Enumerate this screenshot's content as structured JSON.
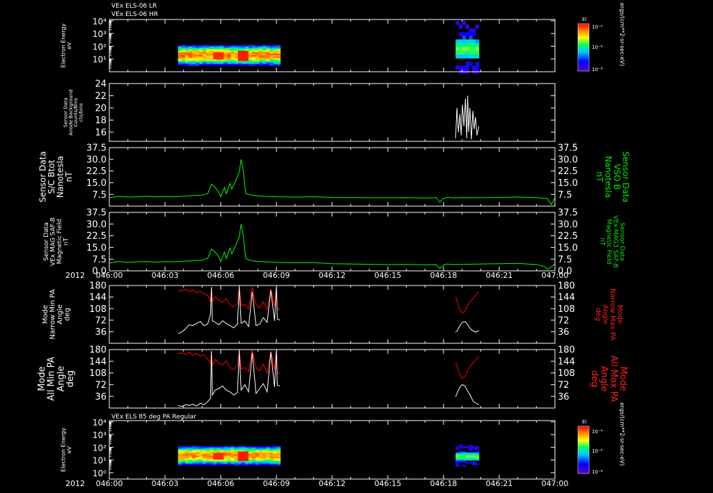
{
  "header": {
    "line1": "VEx ELS-06 LR",
    "line2": "VEx ELS-06 HR",
    "panel7_title": "VEx ELS 85 deg PA Regular"
  },
  "colors": {
    "background": "#000000",
    "frame": "#ffffff",
    "white_line": "#ffffff",
    "green_line": "#00ff00",
    "red_line": "#ff0000",
    "green_label": "#00ee00",
    "red_label": "#ff2020"
  },
  "colorbar": {
    "title": "El",
    "unit": "ergs/(cm**2-sr-sec-eV)",
    "ticks": [
      "10⁻⁴",
      "10⁻⁶",
      "10⁻⁸"
    ]
  },
  "time_axis": {
    "year": "2012",
    "ticks": [
      "046:00",
      "046:03",
      "046:06",
      "046:09",
      "046:12",
      "046:15",
      "046:18",
      "046:21",
      "047:00"
    ]
  },
  "chart_data": [
    {
      "type": "heatmap",
      "panel": "els-lr-hr-spectrogram",
      "ylabel": [
        "Electron Energy",
        "eV"
      ],
      "yticks": [
        "10⁴",
        "10³",
        "10²",
        "10¹"
      ],
      "yscale": "log",
      "ylim_exp": [
        0,
        4.1
      ],
      "blocks": [
        {
          "t": [
            3.7,
            9.2
          ],
          "e_exp": [
            0.5,
            2.1
          ],
          "kind": "dense"
        },
        {
          "t": [
            18.65,
            19.9
          ],
          "e_exp": [
            -0.1,
            4.0
          ],
          "kind": "sparse"
        }
      ]
    },
    {
      "type": "line",
      "panel": "anode-background",
      "ylabel": [
        "Sensor Data",
        "Anode Background",
        "Counts/Bins",
        "cts/bins"
      ],
      "yticks": [
        "24",
        "22",
        "20",
        "18",
        "16"
      ],
      "ylim": [
        14.5,
        24
      ],
      "series": [
        {
          "color": "white",
          "x": [
            18.65,
            18.72,
            18.8,
            18.88,
            18.95,
            19.02,
            19.1,
            19.18,
            19.25,
            19.3,
            19.35,
            19.42,
            19.5,
            19.58,
            19.65,
            19.72,
            19.8,
            19.9
          ],
          "y": [
            15.0,
            20.0,
            16.0,
            19.0,
            15.5,
            20.5,
            17.0,
            21.5,
            15.0,
            22.0,
            16.0,
            20.0,
            14.8,
            19.5,
            16.5,
            18.5,
            15.5,
            17.0
          ]
        }
      ]
    },
    {
      "type": "line",
      "panel": "sc-btot",
      "ylabel": [
        "Sensor Data",
        "S/C Btot",
        "Nanotesla",
        "nT"
      ],
      "ylabel_right": [
        "Sensor Data",
        "VSO B",
        "Nanotesla",
        "nT"
      ],
      "yticks": [
        "37.5",
        "30.0",
        "22.5",
        "15.0",
        "7.5"
      ],
      "ylim": [
        0,
        37.5
      ],
      "series": [
        {
          "color": "green",
          "x": [
            0,
            0.5,
            1,
            1.5,
            2,
            2.5,
            3,
            3.5,
            4,
            4.5,
            5,
            5.3,
            5.5,
            5.7,
            5.9,
            6.0,
            6.2,
            6.3,
            6.5,
            6.6,
            6.8,
            6.9,
            7.0,
            7.1,
            7.2,
            7.35,
            7.5,
            7.7,
            8.0,
            8.5,
            9,
            10,
            11,
            12,
            13,
            14,
            15,
            16,
            17,
            17.6,
            17.8,
            18,
            18.2,
            18.5,
            19,
            20,
            21,
            22,
            23,
            23.6,
            23.8,
            24
          ],
          "y": [
            5.5,
            6.2,
            5.8,
            6.0,
            6.3,
            5.9,
            6.1,
            6.0,
            6.4,
            6.8,
            7.0,
            8.0,
            14.0,
            12.0,
            9.0,
            6.0,
            12.0,
            8.0,
            14.5,
            11.0,
            16.0,
            19.0,
            22.0,
            30.0,
            24.0,
            8.0,
            7.5,
            7.0,
            6.5,
            6.2,
            6.0,
            5.8,
            6.0,
            5.6,
            5.5,
            5.4,
            5.3,
            5.4,
            5.2,
            5.5,
            2.5,
            5.0,
            5.6,
            5.2,
            5.5,
            5.4,
            5.6,
            5.8,
            5.5,
            4.8,
            1.0,
            5.5
          ]
        }
      ]
    },
    {
      "type": "line",
      "panel": "mag-saf-b",
      "ylabel": [
        "Sensor Data",
        "VEx MAG SAF-B",
        "Magnetic Field",
        "nT"
      ],
      "ylabel_right": [
        "Sensor Data",
        "VEx MAG3 SAF-B",
        "Magnetic Field",
        "nT"
      ],
      "yticks": [
        "37.5",
        "30.0",
        "22.5",
        "15.0",
        "7.5",
        "0.0"
      ],
      "ylim": [
        0,
        37.5
      ],
      "series": [
        {
          "color": "green",
          "x": [
            0,
            0.5,
            1,
            1.5,
            2,
            2.5,
            3,
            3.5,
            4,
            4.5,
            5,
            5.3,
            5.5,
            5.7,
            5.9,
            6.0,
            6.2,
            6.3,
            6.5,
            6.6,
            6.8,
            6.9,
            7.0,
            7.1,
            7.2,
            7.35,
            7.5,
            7.7,
            8.0,
            8.5,
            9,
            10,
            11,
            12,
            13,
            14,
            15,
            16,
            17,
            17.6,
            17.8,
            18,
            18.2,
            18.5,
            19,
            20,
            21,
            22,
            23,
            23.4,
            23.6,
            23.8,
            24
          ],
          "y": [
            5.0,
            6.0,
            5.5,
            5.8,
            6.0,
            5.6,
            5.9,
            5.8,
            6.1,
            6.5,
            6.8,
            8.0,
            14.0,
            12.0,
            9.0,
            6.0,
            12.0,
            8.0,
            14.5,
            11.0,
            16.0,
            19.0,
            22.0,
            30.0,
            24.0,
            8.0,
            7.0,
            6.5,
            6.0,
            5.8,
            5.5,
            5.2,
            5.3,
            4.6,
            4.4,
            4.2,
            4.0,
            4.1,
            3.9,
            4.0,
            1.5,
            3.8,
            4.4,
            4.0,
            4.2,
            4.4,
            4.6,
            4.8,
            4.0,
            3.0,
            1.0,
            2.5,
            4.5
          ]
        }
      ]
    },
    {
      "type": "line",
      "panel": "narrow-pa",
      "ylabel": [
        "Mode",
        "Narrow Min PA",
        "Angle",
        "deg"
      ],
      "ylabel_right": [
        "Mode",
        "Narrow Max PA",
        "Angle",
        "deg"
      ],
      "yticks": [
        "180",
        "144",
        "108",
        "72",
        "36"
      ],
      "ylim": [
        0,
        180
      ],
      "series": [
        {
          "name": "Narrow Max PA",
          "color": "red",
          "x": [
            3.7,
            3.9,
            4.1,
            4.3,
            4.5,
            4.7,
            4.9,
            5.1,
            5.3,
            5.45,
            5.5,
            5.55,
            5.7,
            5.9,
            6.1,
            6.3,
            6.5,
            6.7,
            6.9,
            7.0,
            7.1,
            7.3,
            7.5,
            7.7,
            7.9,
            8.1,
            8.3,
            8.5,
            8.7,
            8.9,
            9.0,
            9.05,
            9.2
          ],
          "y": [
            160,
            165,
            168,
            160,
            166,
            158,
            162,
            155,
            150,
            130,
            175,
            130,
            145,
            135,
            128,
            140,
            120,
            112,
            125,
            175,
            118,
            120,
            108,
            175,
            120,
            110,
            130,
            105,
            170,
            115,
            178,
            110,
            102
          ]
        },
        {
          "name": "Narrow Min PA",
          "color": "white",
          "x": [
            3.7,
            3.9,
            4.1,
            4.3,
            4.5,
            4.7,
            4.9,
            5.1,
            5.3,
            5.45,
            5.5,
            5.55,
            5.7,
            5.9,
            6.1,
            6.3,
            6.5,
            6.7,
            6.9,
            7.0,
            7.1,
            7.3,
            7.5,
            7.7,
            7.9,
            8.1,
            8.3,
            8.5,
            8.7,
            8.9,
            9.0,
            9.05,
            9.2
          ],
          "y": [
            30,
            35,
            45,
            58,
            55,
            62,
            68,
            55,
            60,
            90,
            175,
            70,
            65,
            58,
            70,
            62,
            55,
            48,
            60,
            175,
            62,
            70,
            52,
            160,
            55,
            60,
            80,
            65,
            165,
            70,
            178,
            75,
            72
          ]
        },
        {
          "name": "Narrow Max PA 2",
          "color": "red",
          "x": [
            18.65,
            18.75,
            18.85,
            19.0,
            19.15,
            19.3,
            19.45,
            19.6,
            19.75,
            19.9
          ],
          "y": [
            145,
            130,
            108,
            95,
            100,
            118,
            132,
            140,
            152,
            160
          ]
        },
        {
          "name": "Narrow Min PA 2",
          "color": "white",
          "x": [
            18.65,
            18.75,
            18.85,
            19.0,
            19.15,
            19.3,
            19.45,
            19.6,
            19.75,
            19.9
          ],
          "y": [
            35,
            40,
            52,
            65,
            68,
            58,
            45,
            38,
            35,
            40
          ]
        }
      ]
    },
    {
      "type": "line",
      "panel": "all-pa",
      "ylabel": [
        "Mode",
        "All Min PA",
        "Angle",
        "deg"
      ],
      "ylabel_right": [
        "Mode",
        "All Max PA",
        "Angle",
        "deg"
      ],
      "yticks": [
        "180",
        "144",
        "108",
        "72",
        "36"
      ],
      "ylim": [
        0,
        180
      ],
      "series": [
        {
          "name": "All Max PA",
          "color": "red",
          "x": [
            3.7,
            3.9,
            4.1,
            4.3,
            4.5,
            4.7,
            4.9,
            5.1,
            5.3,
            5.45,
            5.5,
            5.55,
            5.7,
            5.9,
            6.1,
            6.3,
            6.5,
            6.7,
            6.9,
            7.0,
            7.1,
            7.3,
            7.5,
            7.7,
            7.9,
            8.1,
            8.3,
            8.5,
            8.7,
            8.9,
            9.0,
            9.05,
            9.2
          ],
          "y": [
            168,
            170,
            165,
            172,
            162,
            168,
            160,
            165,
            150,
            140,
            175,
            130,
            150,
            138,
            132,
            145,
            125,
            118,
            130,
            178,
            120,
            125,
            112,
            178,
            125,
            115,
            135,
            108,
            175,
            118,
            180,
            110,
            105
          ]
        },
        {
          "name": "All Min PA",
          "color": "white",
          "x": [
            3.7,
            3.9,
            4.1,
            4.3,
            4.5,
            4.7,
            4.9,
            5.1,
            5.3,
            5.45,
            5.5,
            5.55,
            5.7,
            5.9,
            6.1,
            6.3,
            6.5,
            6.7,
            6.9,
            7.0,
            7.1,
            7.3,
            7.5,
            7.7,
            7.9,
            8.1,
            8.3,
            8.5,
            8.7,
            8.9,
            9.0,
            9.05,
            9.2
          ],
          "y": [
            8,
            5,
            10,
            8,
            12,
            6,
            15,
            10,
            20,
            30,
            175,
            40,
            55,
            60,
            68,
            55,
            50,
            40,
            48,
            175,
            55,
            72,
            50,
            170,
            45,
            60,
            75,
            50,
            172,
            65,
            180,
            70,
            68
          ]
        },
        {
          "name": "All Max PA 2",
          "color": "red",
          "x": [
            18.65,
            18.75,
            18.85,
            19.0,
            19.15,
            19.3,
            19.45,
            19.6,
            19.75,
            19.9
          ],
          "y": [
            140,
            125,
            105,
            92,
            98,
            115,
            130,
            140,
            150,
            158
          ]
        },
        {
          "name": "All Min PA 2",
          "color": "white",
          "x": [
            18.65,
            18.75,
            18.85,
            19.0,
            19.15,
            19.3,
            19.45,
            19.6,
            19.75,
            19.9
          ],
          "y": [
            35,
            48,
            62,
            72,
            68,
            52,
            38,
            20,
            15,
            10
          ]
        }
      ]
    },
    {
      "type": "heatmap",
      "panel": "els-85deg-spectrogram",
      "ylabel": [
        "Electron Energy",
        "eV"
      ],
      "yticks": [
        "10⁴",
        "10³",
        "10²",
        "10¹",
        "10⁰"
      ],
      "yscale": "log",
      "ylim_exp": [
        -0.5,
        4.1
      ],
      "blocks": [
        {
          "t": [
            3.7,
            9.2
          ],
          "e_exp": [
            0.6,
            2.1
          ],
          "kind": "dense"
        },
        {
          "t": [
            18.65,
            19.9
          ],
          "e_exp": [
            0.5,
            2.2
          ],
          "kind": "sparse"
        }
      ]
    }
  ]
}
